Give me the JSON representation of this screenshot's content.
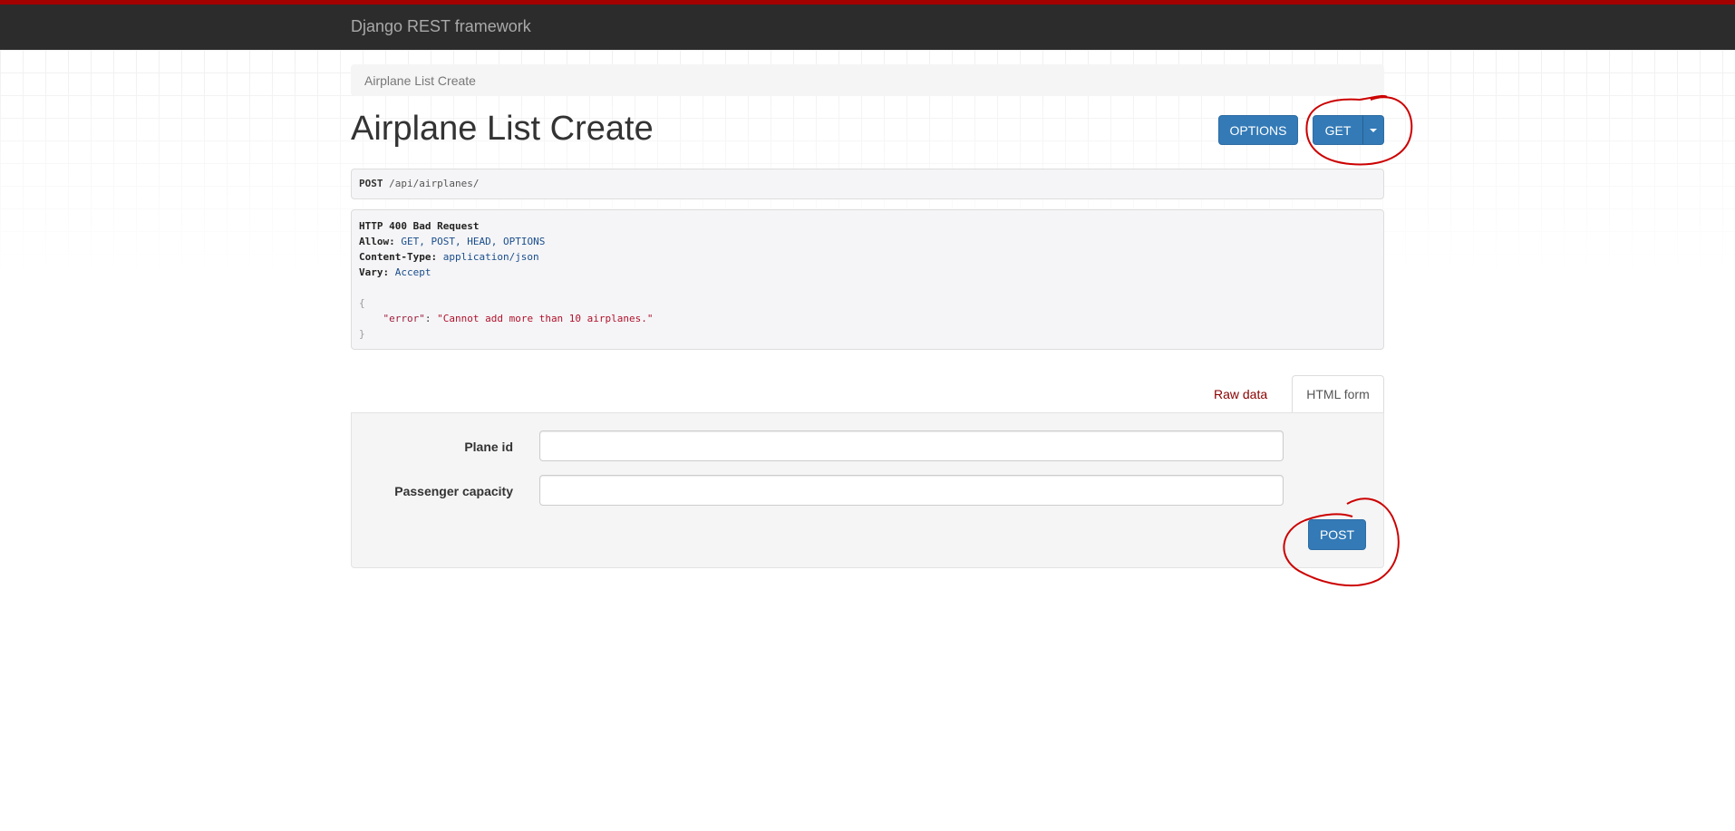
{
  "navbar": {
    "brand": "Django REST framework"
  },
  "breadcrumb": {
    "current": "Airplane List Create"
  },
  "page": {
    "title": "Airplane List Create"
  },
  "toolbar": {
    "options_label": "OPTIONS",
    "get_label": "GET",
    "dropdown_icon": "caret-down-icon"
  },
  "request": {
    "method": "POST",
    "path": "/api/airplanes/"
  },
  "response": {
    "status_line": "HTTP 400 Bad Request",
    "headers": [
      {
        "name": "Allow:",
        "value": "GET, POST, HEAD, OPTIONS"
      },
      {
        "name": "Content-Type:",
        "value": "application/json"
      },
      {
        "name": "Vary:",
        "value": "Accept"
      }
    ],
    "body_open": "{",
    "body_key": "\"error\"",
    "body_sep": ": ",
    "body_value": "\"Cannot add more than 10 airplanes.\"",
    "body_close": "}"
  },
  "tabs": [
    {
      "label": "Raw data",
      "active": false
    },
    {
      "label": "HTML form",
      "active": true
    }
  ],
  "form": {
    "fields": [
      {
        "label": "Plane id",
        "value": ""
      },
      {
        "label": "Passenger capacity",
        "value": ""
      }
    ],
    "submit_label": "POST"
  },
  "colors": {
    "primary": "#337ab7",
    "navbar": "#2c2c2c",
    "accent_red": "#a30000",
    "annotation": "#cc0000"
  }
}
